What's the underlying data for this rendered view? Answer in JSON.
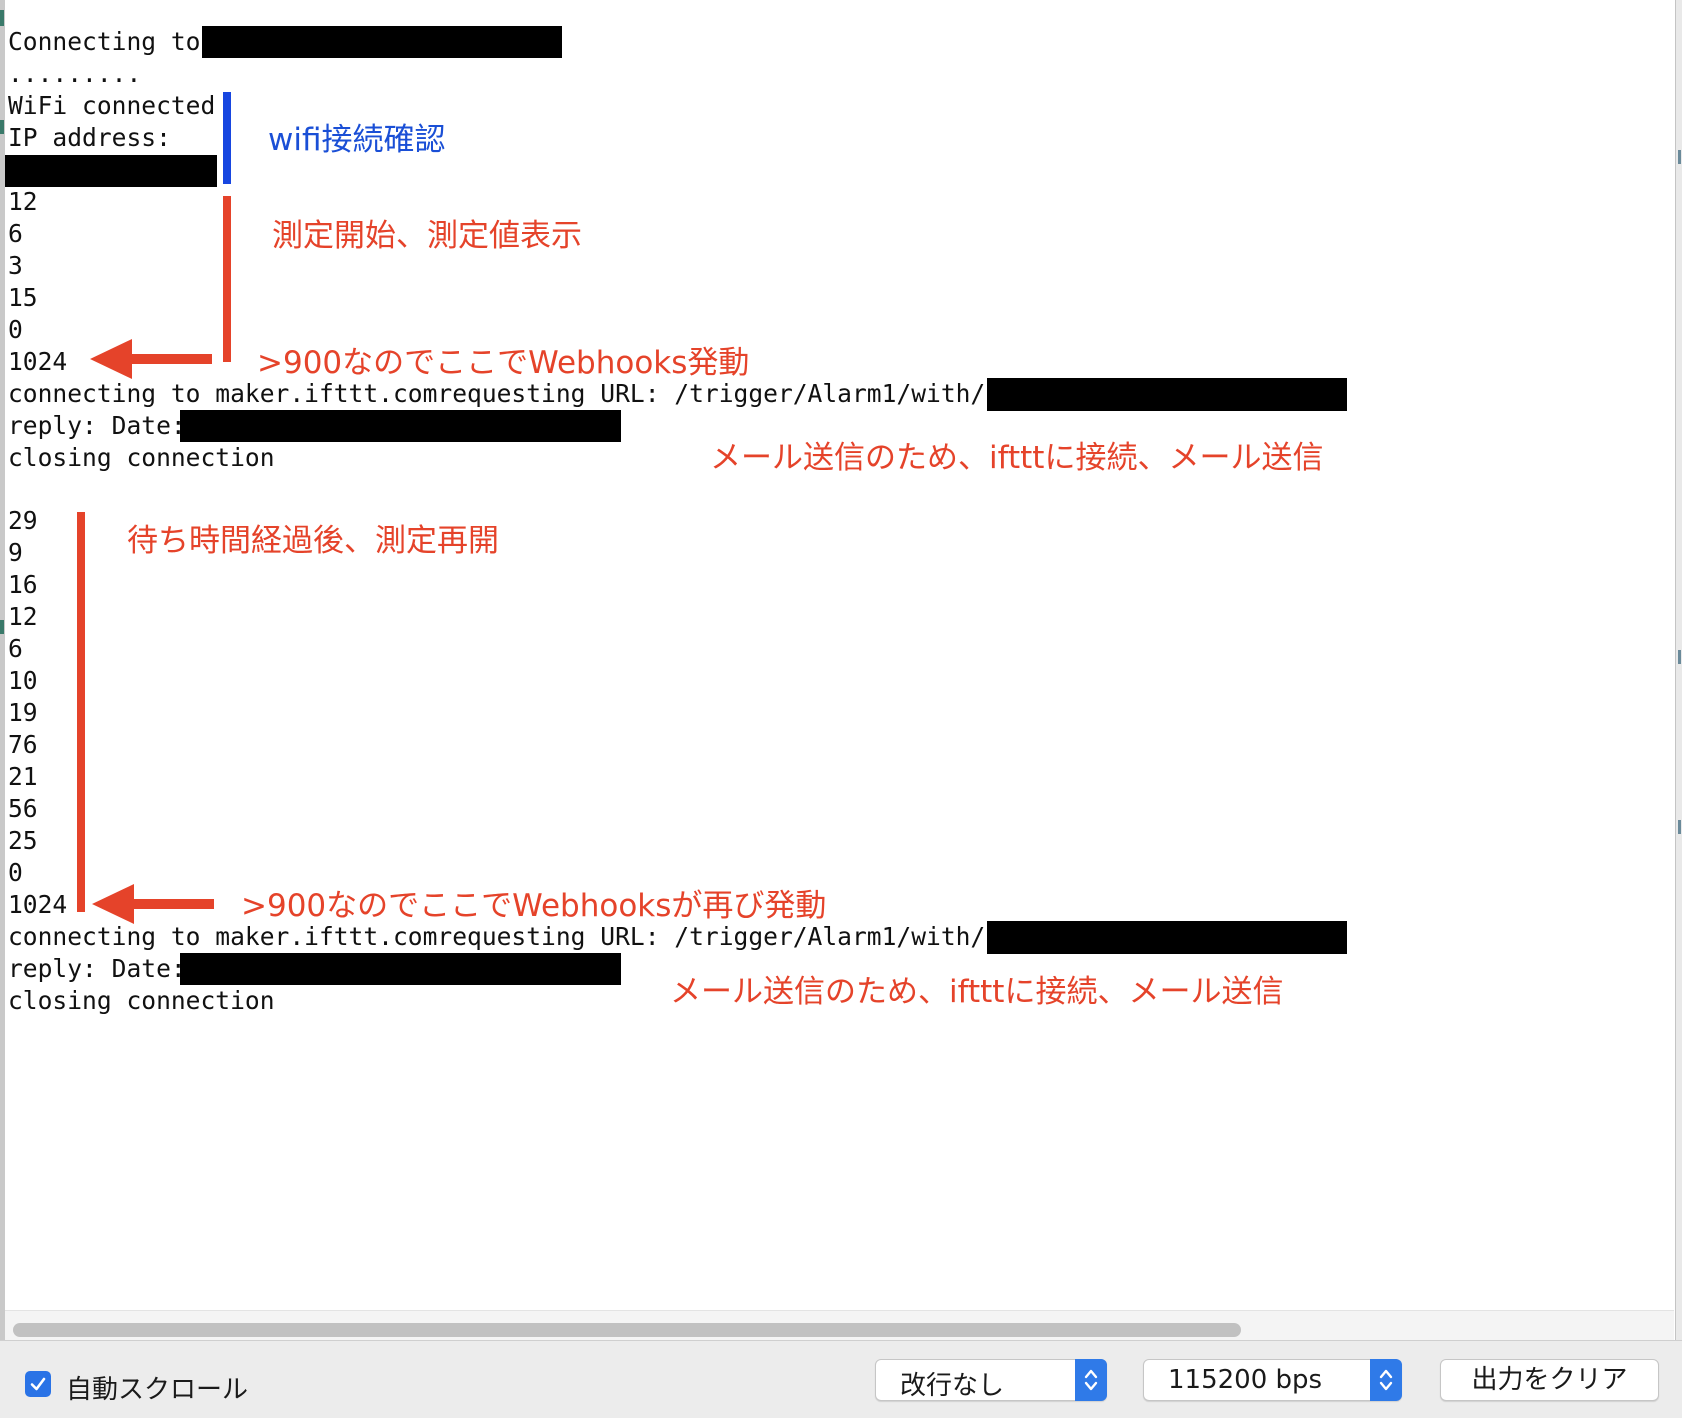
{
  "console": {
    "lines": [
      "Connecting to",
      ".........",
      "WiFi connected",
      "IP address:",
      "",
      "12",
      "6",
      "3",
      "15",
      "0",
      "1024",
      "connecting to maker.ifttt.comrequesting URL: /trigger/Alarm1/with/key/",
      "reply: Date:",
      "closing connection",
      "",
      "29",
      "9",
      "16",
      "12",
      "6",
      "10",
      "19",
      "76",
      "21",
      "56",
      "25",
      "0",
      "1024",
      "connecting to maker.ifttt.comrequesting URL: /trigger/Alarm1/with/key/",
      "reply: Date:",
      "closing connection"
    ]
  },
  "annotations": {
    "wifi": "wifi接続確認",
    "measure_start": "測定開始、測定値表示",
    "trigger1": ">900なのでここでWebhooks発動",
    "mail1": "メール送信のため、iftttに接続、メール送信",
    "restart": "待ち時間経過後、測定再開",
    "trigger2": ">900なのでここでWebhooksが再び発動",
    "mail2": "メール送信のため、iftttに接続、メール送信"
  },
  "statusbar": {
    "autoscroll_label": "自動スクロール",
    "autoscroll_checked": true,
    "line_ending": "改行なし",
    "baud_rate": "115200 bps",
    "clear_label": "出力をクリア"
  },
  "colors": {
    "annotation_red": "#e5432a",
    "annotation_blue": "#1a4fd6",
    "accent_blue": "#2f7ae8"
  }
}
